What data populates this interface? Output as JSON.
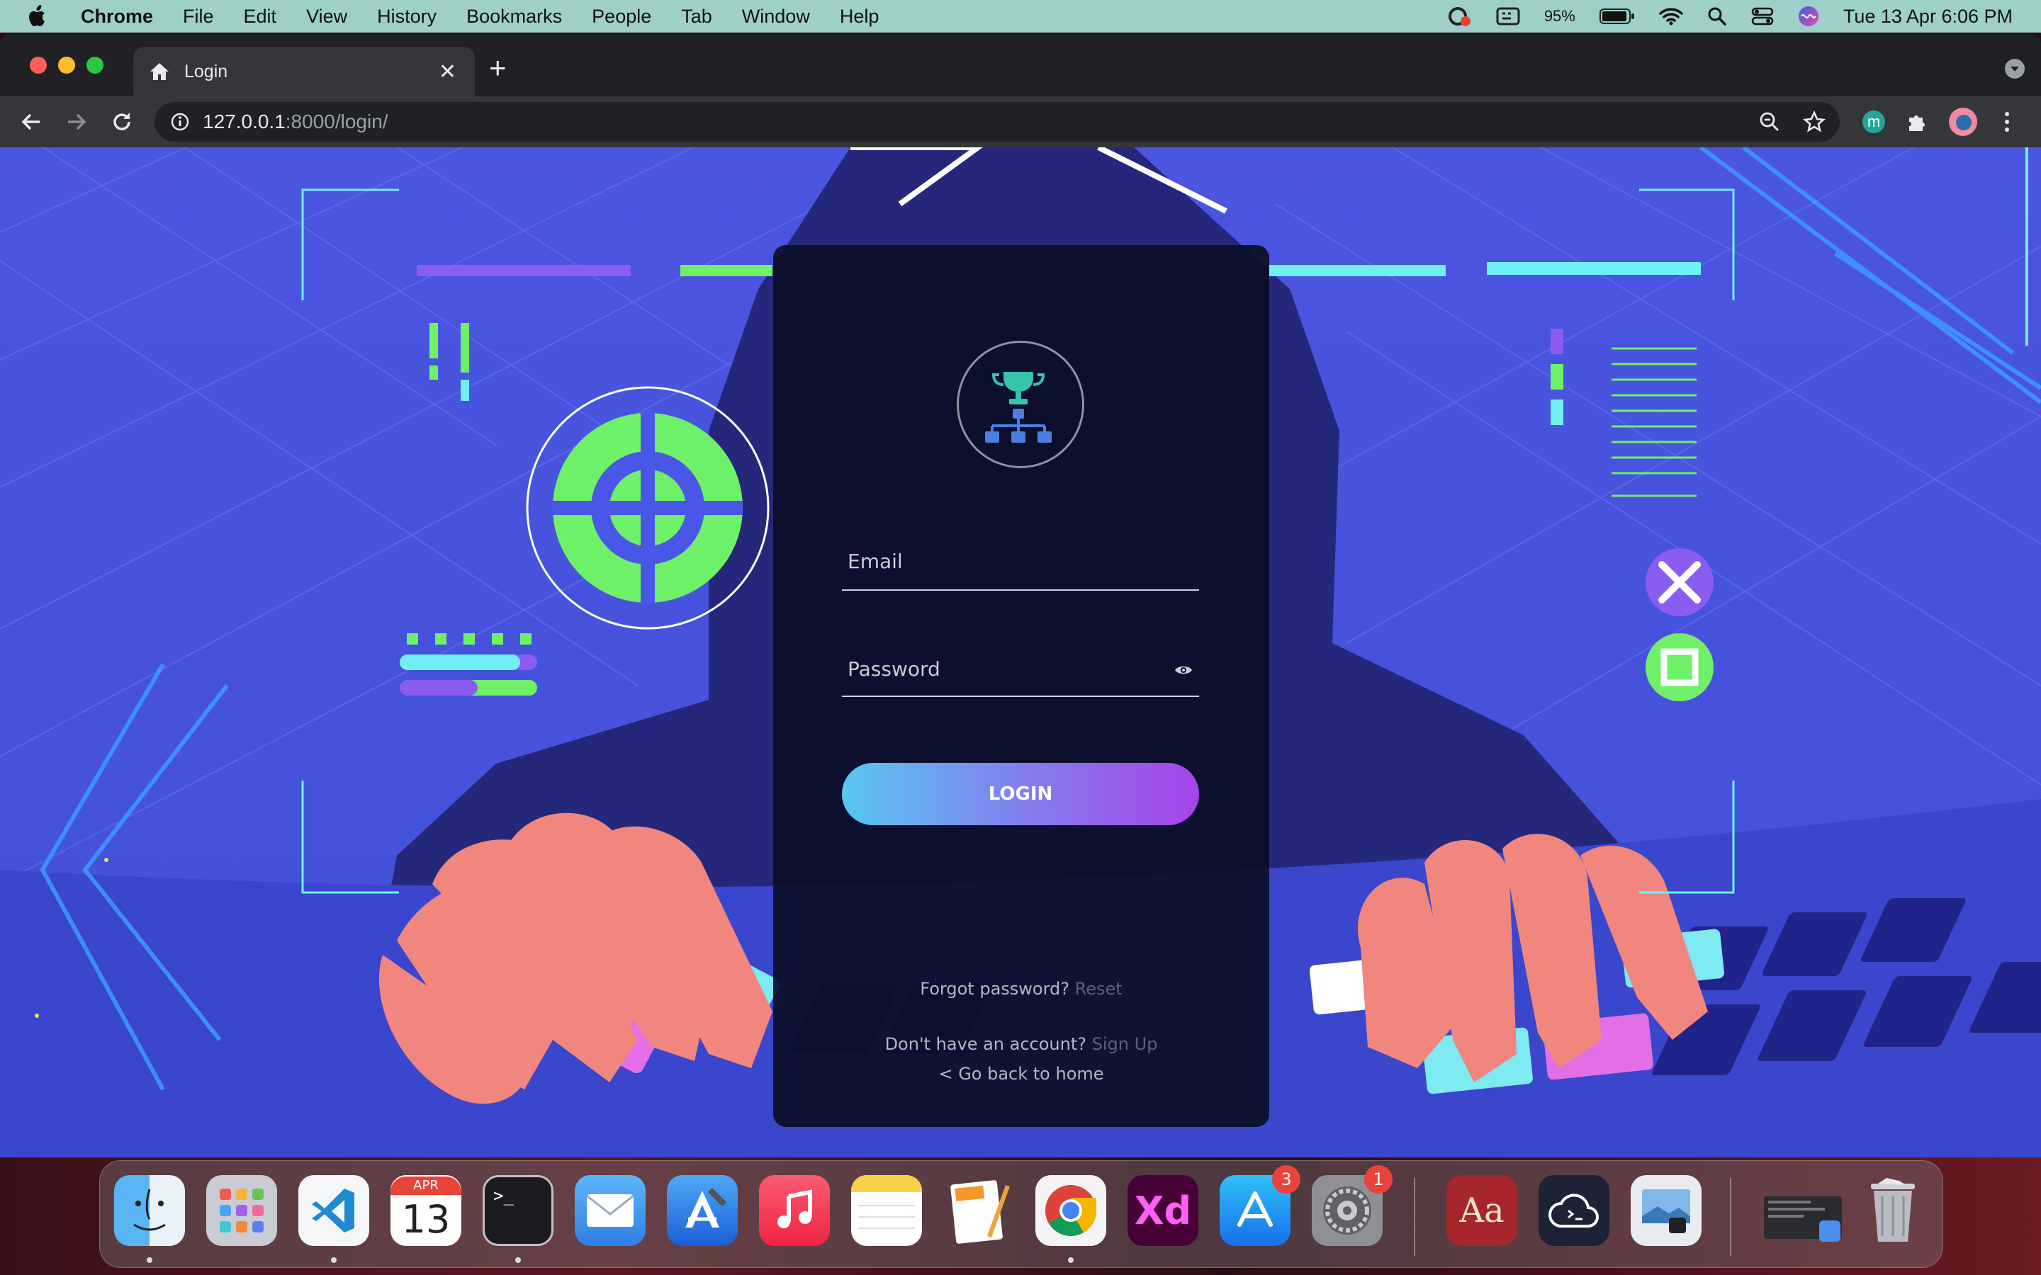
{
  "menubar": {
    "app_name": "Chrome",
    "menus": [
      "File",
      "Edit",
      "View",
      "History",
      "Bookmarks",
      "People",
      "Tab",
      "Window",
      "Help"
    ],
    "battery": "95%",
    "datetime": "Tue 13 Apr  6:06 PM"
  },
  "browser": {
    "tab_title": "Login",
    "url_host": "127.0.0.1",
    "url_rest": ":8000/login/",
    "profile_initial": "m"
  },
  "login": {
    "email_placeholder": "Email",
    "password_placeholder": "Password",
    "login_button": "LOGIN",
    "forgot_text": "Forgot password?",
    "reset_link": "Reset",
    "no_account_text": "Don't have an account?",
    "signup_link": "Sign Up",
    "home_link": "< Go back to home"
  },
  "dock": {
    "calendar_month": "APR",
    "calendar_day": "13",
    "xd_label": "Xd",
    "dictionary_label": "Aa",
    "appstore_badge": "3",
    "settings_badge": "1",
    "terminal_prompt": ">_",
    "apps": [
      "finder-icon",
      "launchpad-icon",
      "vscode-icon",
      "calendar-icon",
      "terminal-icon",
      "mail-icon",
      "xcode-icon",
      "music-icon",
      "notes-icon",
      "pages-icon",
      "chrome-icon",
      "xd-icon",
      "app-store-icon",
      "system-preferences-icon",
      "dictionary-icon",
      "cloud-terminal-icon",
      "preview-icon",
      "downloads-stack-icon",
      "trash-icon"
    ]
  },
  "colors": {
    "menubar_bg": "#9ecfc9",
    "page_bg": "#4a57e6",
    "card_bg": "#0b0e28",
    "neon_green": "#6ef069",
    "neon_cyan": "#6ff0f5",
    "button_gradient_start": "#58c7f0",
    "button_gradient_end": "#a843e8"
  }
}
